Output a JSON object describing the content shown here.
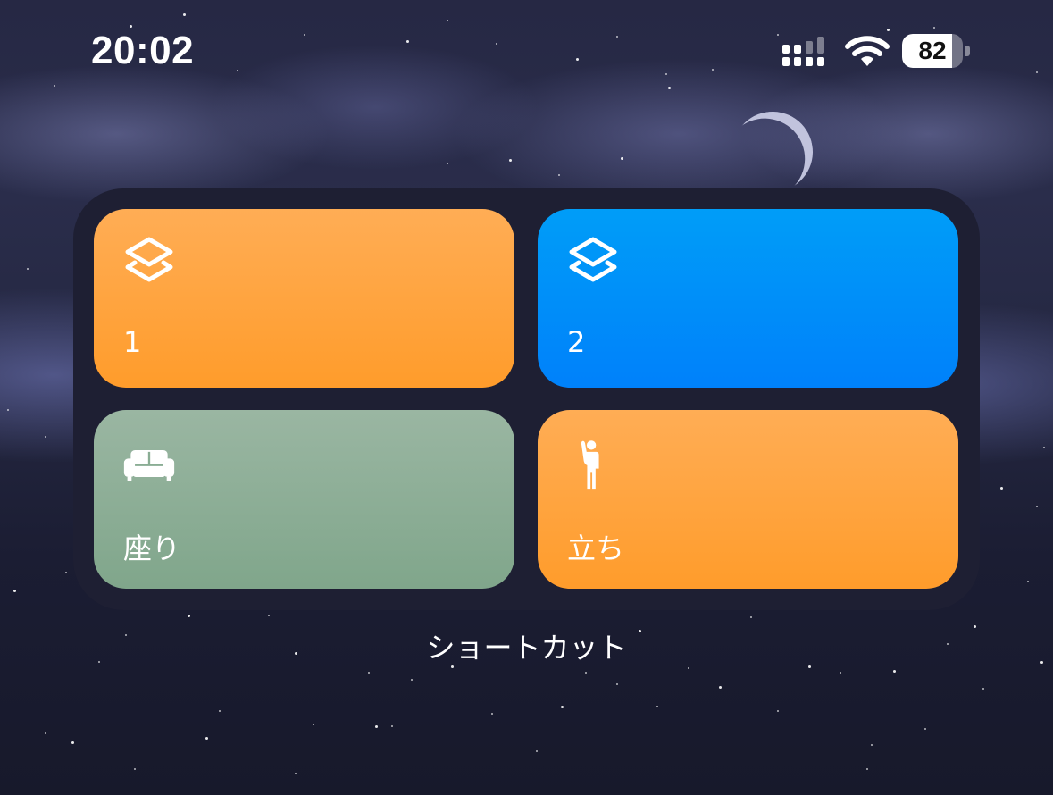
{
  "status_bar": {
    "time": "20:02",
    "battery_level": 82,
    "battery_label": "82",
    "cellular_icon": "cellular-signal-icon",
    "wifi_icon": "wifi-icon",
    "battery_icon": "battery-icon"
  },
  "widget": {
    "caption": "ショートカット",
    "tiles": [
      {
        "label": "1",
        "icon": "shortcuts-layers-icon",
        "color": "#FF9F2F"
      },
      {
        "label": "2",
        "icon": "shortcuts-layers-icon",
        "color": "#0A8EFA"
      },
      {
        "label": "座り",
        "icon": "sofa-icon",
        "color": "#8BAE95"
      },
      {
        "label": "立ち",
        "icon": "standing-person-icon",
        "color": "#FF9F2F"
      }
    ]
  },
  "background": {
    "moon_icon": "crescent-moon-icon"
  }
}
